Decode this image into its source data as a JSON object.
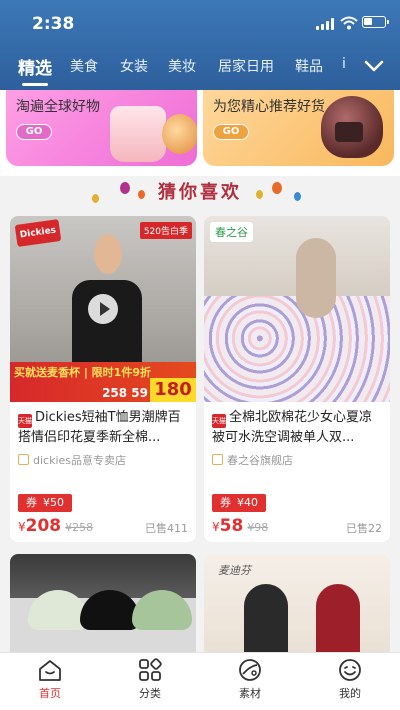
{
  "status": {
    "time": "2:38"
  },
  "tabs": [
    "精选",
    "美食",
    "女装",
    "美妆",
    "居家日用",
    "鞋品",
    "i"
  ],
  "banners": [
    {
      "text": "淘遍全球好物",
      "go": "GO"
    },
    {
      "text": "为您精心推荐好货",
      "go": "GO"
    }
  ],
  "section": {
    "title": "猜你喜欢"
  },
  "products": [
    {
      "brand_badge": "Dickies",
      "overlay_tag": "520告白季",
      "overlay_promo": "买就送麦香杯 | 限时1件9折",
      "overlay_price": "180",
      "overlay_orig": "258 59",
      "platform": "天猫",
      "title": "Dickies短袖T恤男潮牌百搭情侣印花夏季新全棉...",
      "shop": "dickies品意专卖店",
      "coupon_label": "券",
      "coupon_value": "¥50",
      "currency": "¥",
      "price": "208",
      "original_price": "¥258",
      "sold": "已售411"
    },
    {
      "brand_badge": "春之谷",
      "platform": "天猫",
      "title": "全棉北欧棉花少女心夏凉被可水洗空调被单人双...",
      "shop": "春之谷旗舰店",
      "coupon_label": "券",
      "coupon_value": "¥40",
      "currency": "¥",
      "price": "58",
      "original_price": "¥98",
      "sold": "已售22"
    },
    {
      "overlay": ""
    },
    {
      "overlay": "麦迪芬"
    }
  ],
  "nav": [
    {
      "label": "首页",
      "icon": "home-icon",
      "active": true
    },
    {
      "label": "分类",
      "icon": "category-icon",
      "active": false
    },
    {
      "label": "素材",
      "icon": "material-icon",
      "active": false
    },
    {
      "label": "我的",
      "icon": "profile-icon",
      "active": false
    }
  ],
  "colors": {
    "header": "#2d5f9b",
    "accent": "#e03030"
  }
}
